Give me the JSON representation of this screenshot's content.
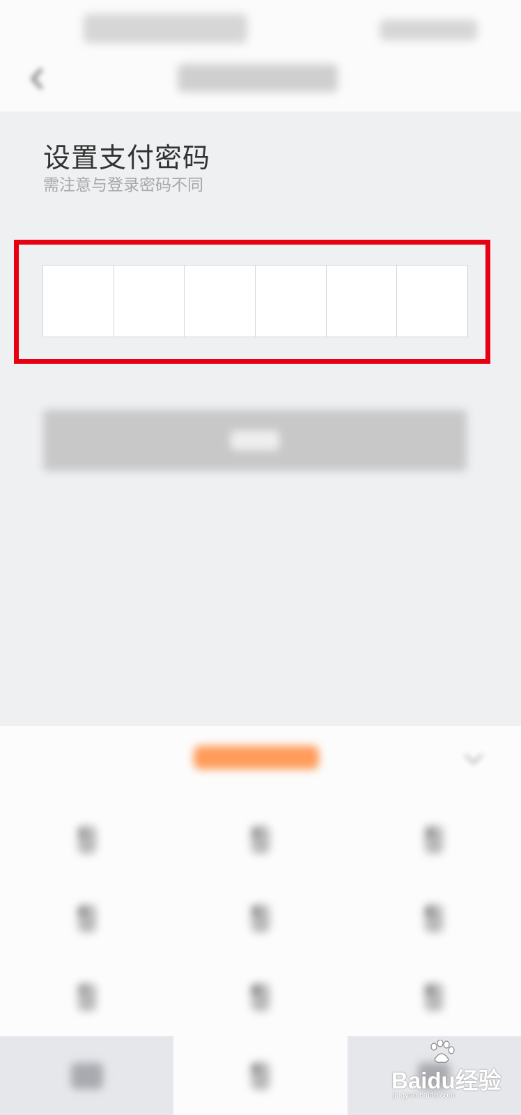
{
  "status_bar": {
    "left_text": "",
    "right_text": ""
  },
  "nav": {
    "back_icon": "chevron-left-icon",
    "title": ""
  },
  "page": {
    "heading": "设置支付密码",
    "subheading": "需注意与登录密码不同"
  },
  "pin": {
    "length": 6,
    "entered": 0
  },
  "confirm_button": {
    "label": "",
    "state": "disabled"
  },
  "keyboard": {
    "title": "",
    "collapse_icon": "chevron-down-icon",
    "keys": [
      "1",
      "2",
      "3",
      "4",
      "5",
      "6",
      "7",
      "8",
      "9",
      "",
      "0",
      ""
    ],
    "backspace_icon": "backspace-icon"
  },
  "colors": {
    "background": "#eff0f2",
    "highlight_border": "#e60012",
    "keyboard_title_accent": "#ff9c5a",
    "disabled_button": "#c8c8c8"
  },
  "watermark": {
    "logo_text": "Baidu经验",
    "url": "jingyan.baidu.com"
  }
}
